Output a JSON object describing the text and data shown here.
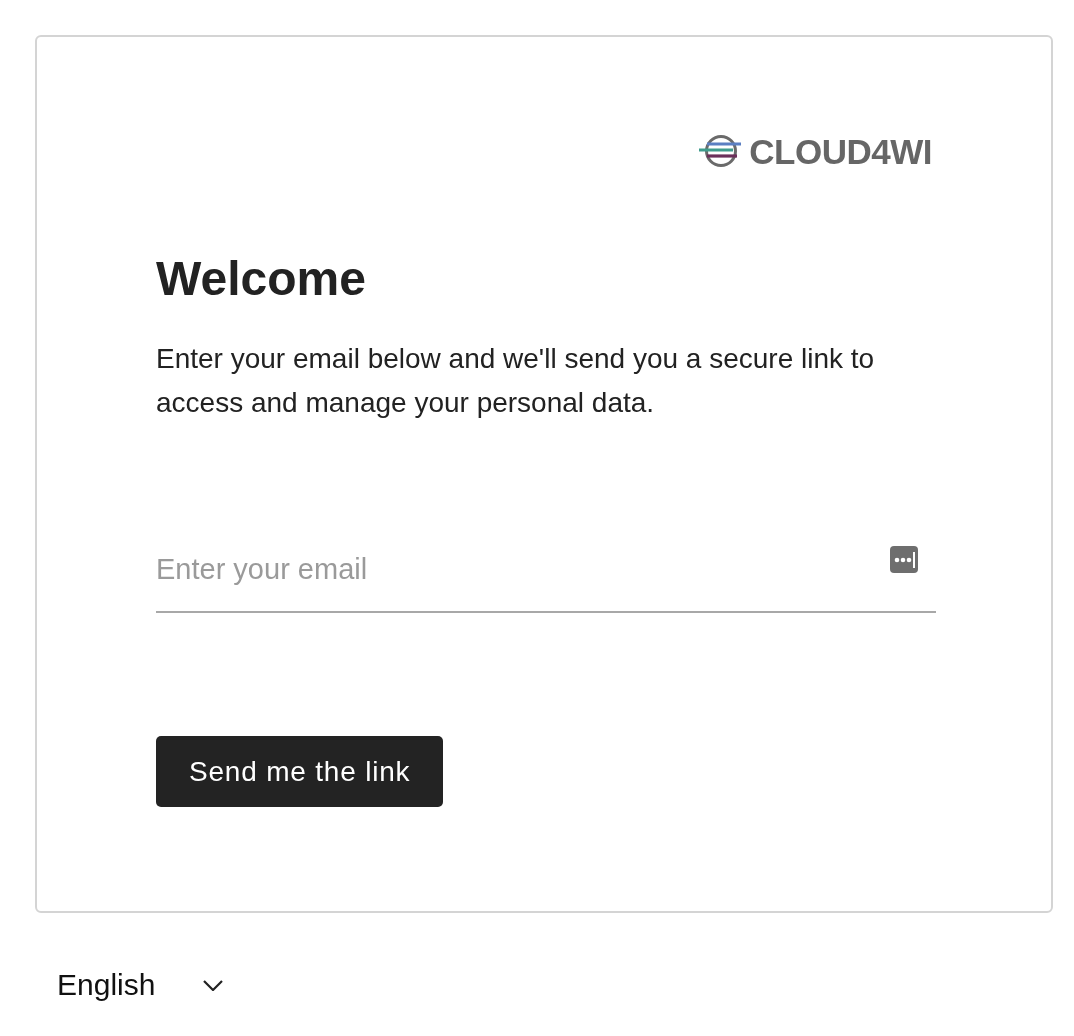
{
  "logo": {
    "text": "CLOUD4WI"
  },
  "heading": "Welcome",
  "description": "Enter your email below and we'll send you a secure link to access and manage your personal data.",
  "email_field": {
    "placeholder": "Enter your email"
  },
  "submit_button": {
    "label": "Send me the link"
  },
  "language_selector": {
    "value": "English"
  }
}
